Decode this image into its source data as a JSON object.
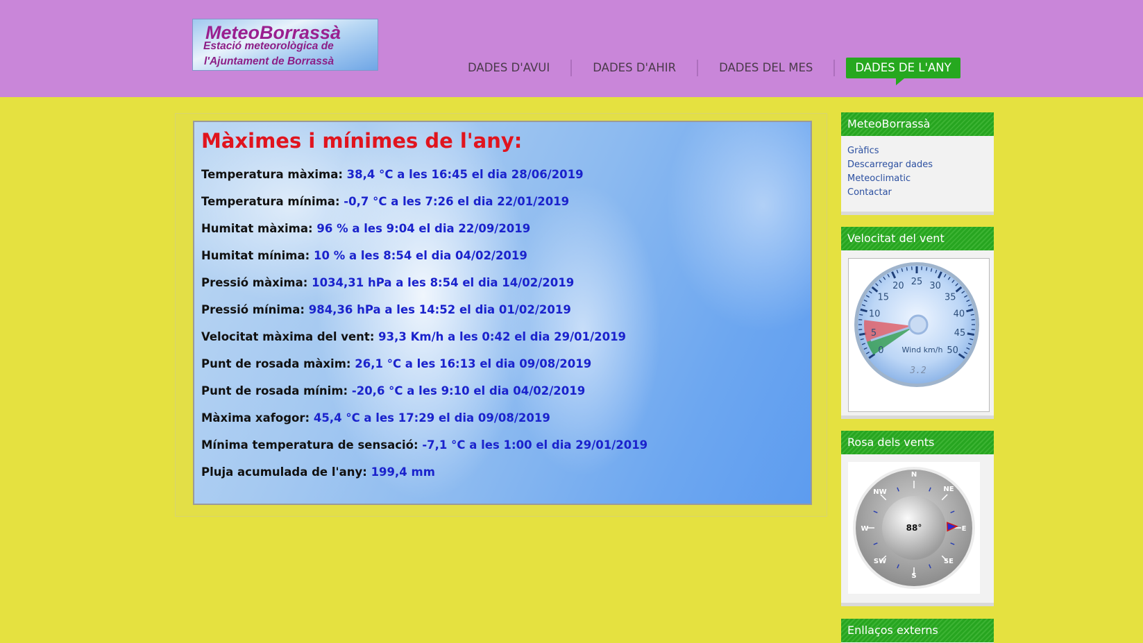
{
  "logo": {
    "line1": "MeteoBorrassà",
    "line2": "Estació meteorològica de",
    "line3": "l'Ajuntament de Borrassà"
  },
  "nav": {
    "items": [
      {
        "label": "DADES D'AVUI"
      },
      {
        "label": "DADES D'AHIR"
      },
      {
        "label": "DADES DEL MES"
      },
      {
        "label": "DADES DE L'ANY"
      }
    ],
    "active_index": 3
  },
  "main": {
    "title": "Màximes i mínimes de l'any:",
    "rows": [
      {
        "label": "Temperatura màxima:",
        "value": "38,4 °C a les 16:45 el dia 28/06/2019"
      },
      {
        "label": "Temperatura mínima:",
        "value": "-0,7 °C a les 7:26 el dia 22/01/2019"
      },
      {
        "label": "Humitat màxima:",
        "value": "96 % a les 9:04 el dia 22/09/2019"
      },
      {
        "label": "Humitat mínima:",
        "value": "10 % a les 8:54 el dia 04/02/2019"
      },
      {
        "label": "Pressió màxima:",
        "value": "1034,31 hPa a les 8:54 el dia 14/02/2019"
      },
      {
        "label": "Pressió mínima:",
        "value": "984,36 hPa a les 14:52 el dia 01/02/2019"
      },
      {
        "label": "Velocitat màxima del vent:",
        "value": "93,3 Km/h a les 0:42 el dia 29/01/2019"
      },
      {
        "label": "Punt de rosada màxim:",
        "value": "26,1 °C a les 16:13 el dia 09/08/2019"
      },
      {
        "label": "Punt de rosada mínim:",
        "value": "-20,6 °C a les 9:10 el dia 04/02/2019"
      },
      {
        "label": "Màxima xafogor:",
        "value": "45,4 °C a les 17:29 el dia 09/08/2019"
      },
      {
        "label": "Mínima temperatura de sensació:",
        "value": "-7,1 °C a les 1:00 el dia 29/01/2019"
      },
      {
        "label": "Pluja acumulada de l'any:",
        "value": "199,4 mm"
      }
    ]
  },
  "sidebar": {
    "meteo": {
      "title": "MeteoBorrassà",
      "links": [
        "Gràfics",
        "Descarregar dades",
        "Meteoclimatic",
        "Contactar"
      ]
    },
    "wind": {
      "title": "Velocitat del vent",
      "gauge_label": "Wind km/h",
      "readout": "3.2",
      "ticks": [
        "0",
        "5",
        "10",
        "15",
        "20",
        "25",
        "30",
        "35",
        "40",
        "45",
        "50"
      ],
      "value": 3.2,
      "max": 50
    },
    "rose": {
      "title": "Rosa dels vents",
      "center_label": "88°",
      "direction_deg": 88,
      "cardinals": {
        "n": "N",
        "ne": "NE",
        "e": "E",
        "se": "SE",
        "s": "S",
        "sw": "SW",
        "w": "W",
        "nw": "NW"
      }
    },
    "external": {
      "title": "Enllaços externs"
    }
  },
  "colors": {
    "header_bg": "#c986d9",
    "page_bg": "#e5e140",
    "accent_green": "#26a81f",
    "title_red": "#e0141e",
    "value_blue": "#1a22cc"
  }
}
